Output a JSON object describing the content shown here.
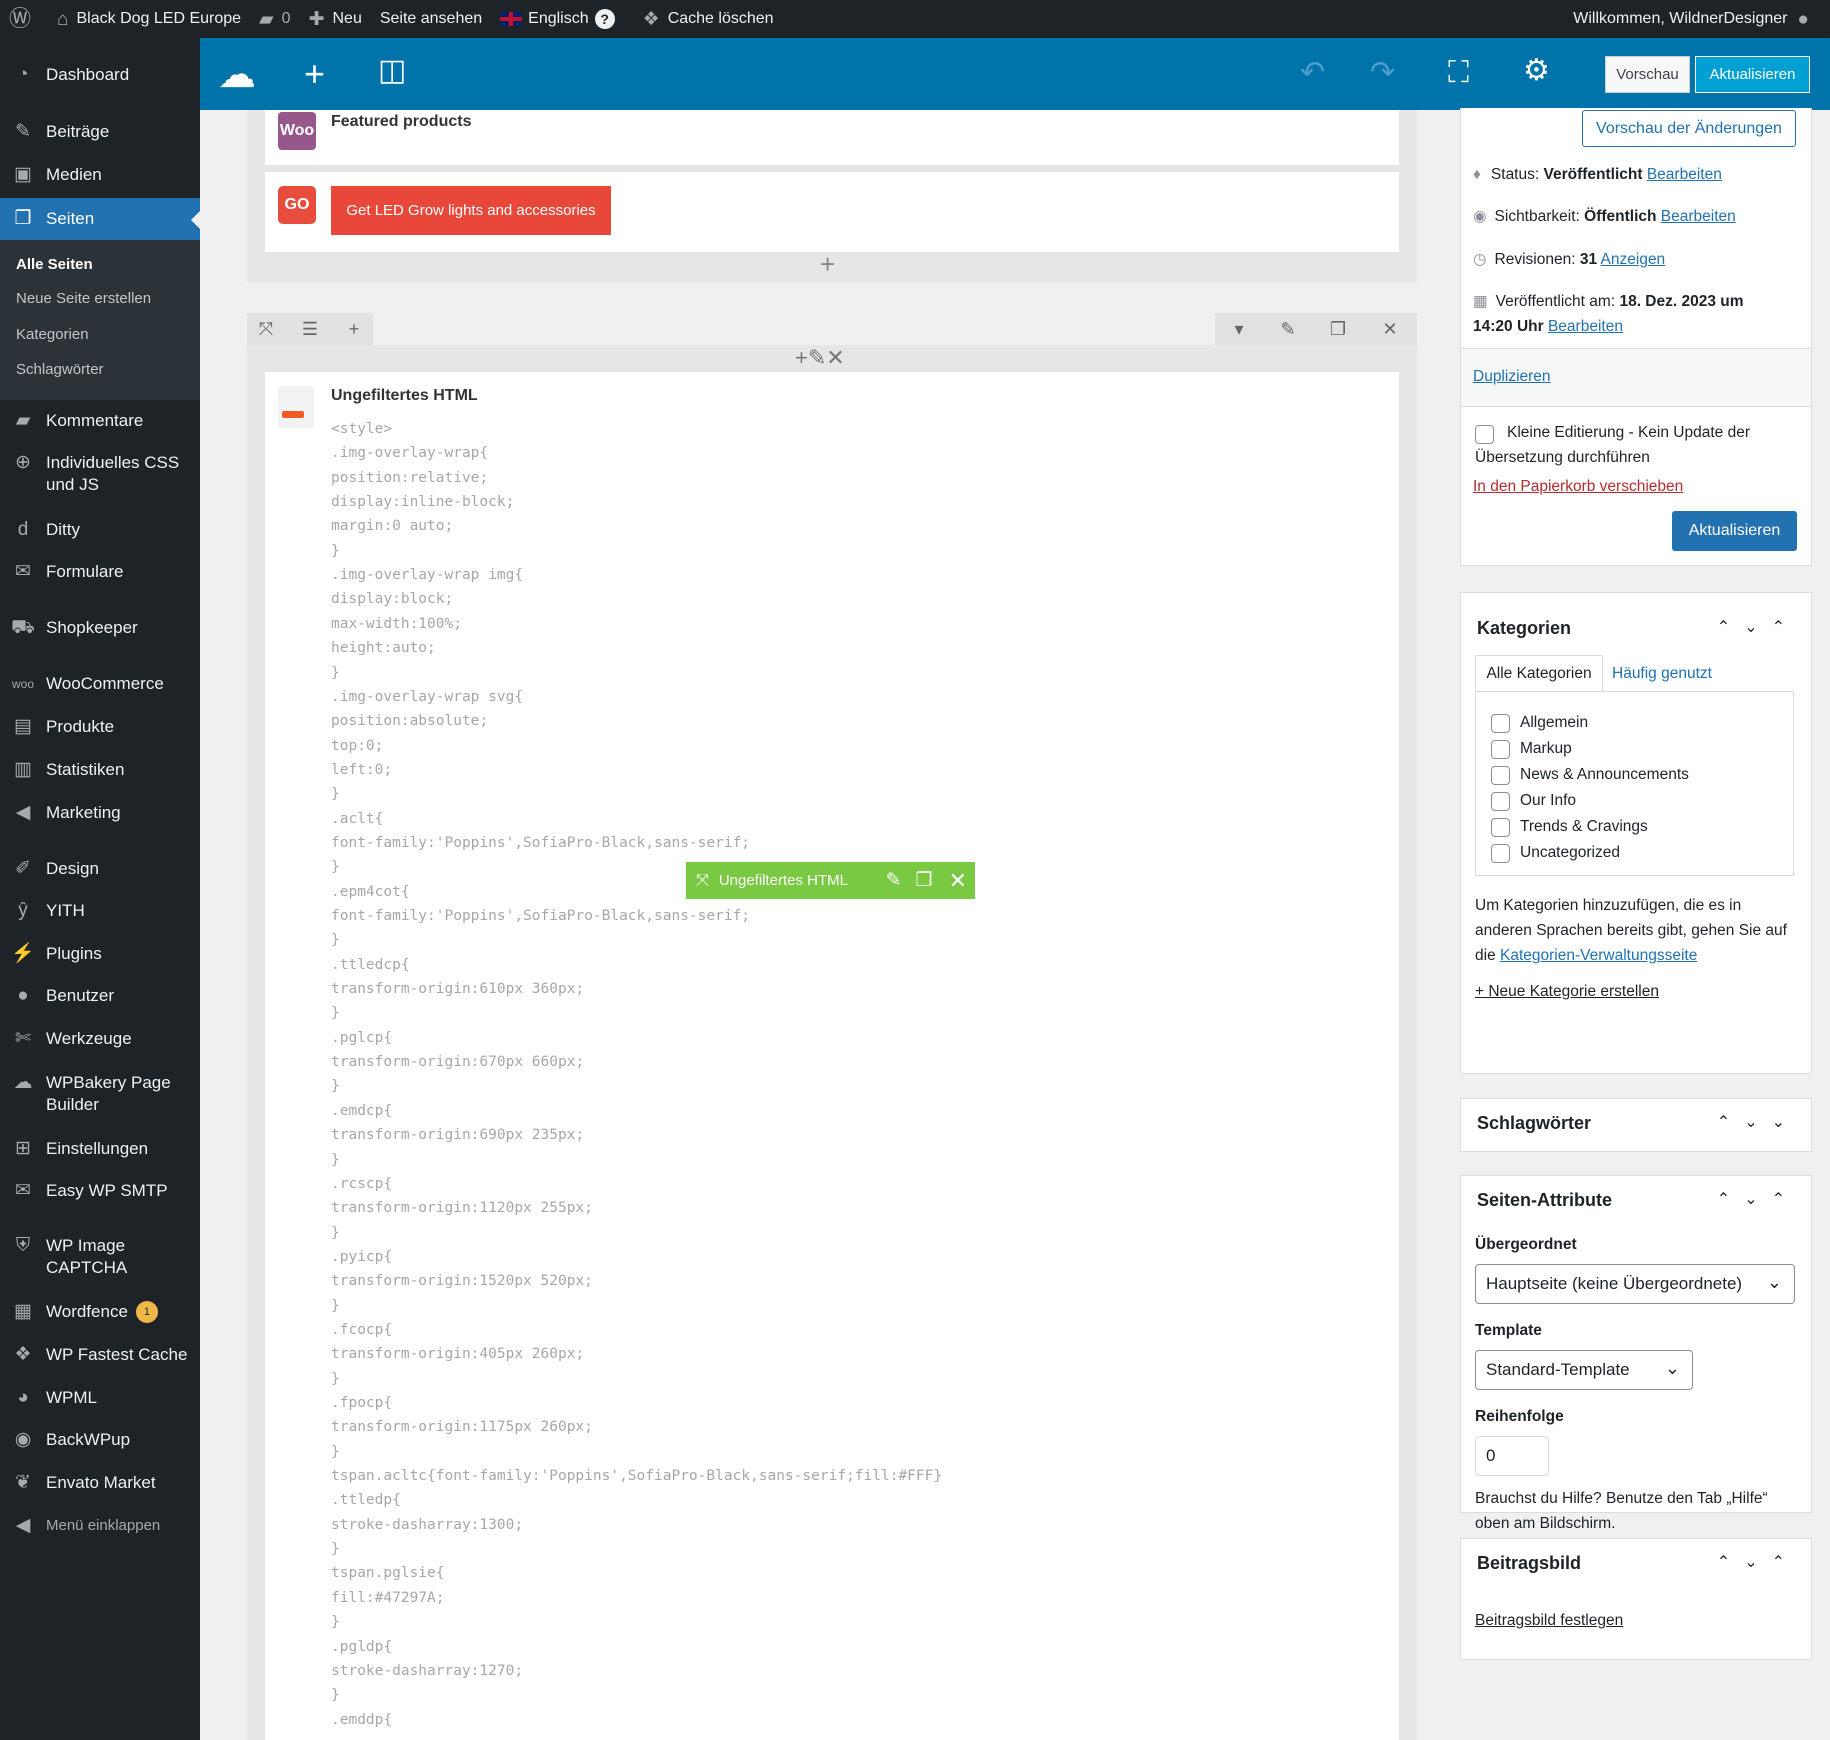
{
  "adminbar": {
    "site_name": "Black Dog LED Europe",
    "comments_count": "0",
    "new_label": "Neu",
    "view_page_label": "Seite ansehen",
    "language_label": "Englisch",
    "help_label": "?",
    "cache_label": "Cache löschen",
    "welcome": "Willkommen, WildnerDesigner"
  },
  "sidebar": {
    "items": [
      {
        "label": "Dashboard",
        "icon": "gauge-icon"
      },
      {
        "label": "Beiträge",
        "icon": "pin-icon"
      },
      {
        "label": "Medien",
        "icon": "media-icon"
      },
      {
        "label": "Seiten",
        "icon": "pages-icon"
      },
      {
        "label": "Kommentare",
        "icon": "comment-icon"
      },
      {
        "label": "Individuelles CSS und JS",
        "icon": "plus-circle-icon"
      },
      {
        "label": "Ditty",
        "icon": "ditty-icon"
      },
      {
        "label": "Formulare",
        "icon": "mail-icon"
      },
      {
        "label": "Shopkeeper",
        "icon": "cart-icon"
      },
      {
        "label": "WooCommerce",
        "icon": "woo-icon"
      },
      {
        "label": "Produkte",
        "icon": "archive-icon"
      },
      {
        "label": "Statistiken",
        "icon": "bar-chart-icon"
      },
      {
        "label": "Marketing",
        "icon": "megaphone-icon"
      },
      {
        "label": "Design",
        "icon": "brush-icon"
      },
      {
        "label": "YITH",
        "icon": "yith-icon"
      },
      {
        "label": "Plugins",
        "icon": "plug-icon"
      },
      {
        "label": "Benutzer",
        "icon": "user-icon"
      },
      {
        "label": "Werkzeuge",
        "icon": "wrench-icon"
      },
      {
        "label": "WPBakery Page Builder",
        "icon": "cloud-icon"
      },
      {
        "label": "Einstellungen",
        "icon": "settings-icon"
      },
      {
        "label": "Easy WP SMTP",
        "icon": "smtp-icon"
      },
      {
        "label": "WP Image CAPTCHA",
        "icon": "shield-icon"
      },
      {
        "label": "Wordfence",
        "icon": "wordfence-icon",
        "badge": "1"
      },
      {
        "label": "WP Fastest Cache",
        "icon": "cheetah-icon"
      },
      {
        "label": "WPML",
        "icon": "wpml-icon"
      },
      {
        "label": "BackWPup",
        "icon": "backwpup-icon"
      },
      {
        "label": "Envato Market",
        "icon": "leaf-icon"
      },
      {
        "label": "Menü einklappen",
        "icon": "collapse-icon"
      }
    ],
    "submenu": [
      "Alle Seiten",
      "Neue Seite erstellen",
      "Kategorien",
      "Schlagwörter"
    ]
  },
  "toolbar": {
    "preview_label": "Vorschau",
    "update_label": "Aktualisieren"
  },
  "editor": {
    "featured_title": "Featured products",
    "woo_logo": "Woo",
    "go_logo": "GO",
    "go_button": "Get LED Grow lights and accessories",
    "html_title": "Ungefiltertes HTML",
    "hover_label": "Ungefiltertes HTML",
    "code_lines": [
      "<style>",
      ".img-overlay-wrap{",
      "position:relative;",
      "display:inline-block;",
      "margin:0 auto;",
      "}",
      ".img-overlay-wrap img{",
      "display:block;",
      "max-width:100%;",
      "height:auto;",
      "}",
      ".img-overlay-wrap svg{",
      "position:absolute;",
      "top:0;",
      "left:0;",
      "}",
      ".aclt{",
      "font-family:'Poppins',SofiaPro-Black,sans-serif;",
      "}",
      ".epm4cot{",
      "font-family:'Poppins',SofiaPro-Black,sans-serif;",
      "}",
      ".ttledcp{",
      "transform-origin:610px 360px;",
      "}",
      ".pglcp{",
      "transform-origin:670px 660px;",
      "}",
      ".emdcp{",
      "transform-origin:690px 235px;",
      "}",
      ".rcscp{",
      "transform-origin:1120px 255px;",
      "}",
      ".pyicp{",
      "transform-origin:1520px 520px;",
      "}",
      ".fcocp{",
      "transform-origin:405px 260px;",
      "}",
      ".fpocp{",
      "transform-origin:1175px 260px;",
      "}",
      "tspan.acltc{font-family:'Poppins',SofiaPro-Black,sans-serif;fill:#FFF}",
      ".ttledp{",
      "stroke-dasharray:1300;",
      "}",
      "tspan.pglsie{",
      "fill:#47297A;",
      "}",
      ".pgldp{",
      "stroke-dasharray:1270;",
      "}",
      ".emddp{"
    ]
  },
  "publish": {
    "preview_changes": "Vorschau der Änderungen",
    "status_label": "Status:",
    "status_value": "Veröffentlicht",
    "visibility_label": "Sichtbarkeit:",
    "visibility_value": "Öffentlich",
    "revisions_label": "Revisionen:",
    "revisions_value": "31",
    "revisions_link": "Anzeigen",
    "published_label": "Veröffentlicht am:",
    "published_date": "18. Dez. 2023 um",
    "published_time": "14:20 Uhr",
    "edit_link": "Bearbeiten",
    "duplicate": "Duplizieren",
    "minor_edit": "Kleine Editierung - Kein Update der Übersetzung durchführen",
    "trash": "In den Papierkorb verschieben",
    "update": "Aktualisieren"
  },
  "categories": {
    "title": "Kategorien",
    "tab_all": "Alle Kategorien",
    "tab_popular": "Häufig genutzt",
    "items": [
      "Allgemein",
      "Markup",
      "News & Announcements",
      "Our Info",
      "Trends & Cravings",
      "Uncategorized"
    ],
    "help_text": "Um Kategorien hinzuzufügen, die es in anderen Sprachen bereits gibt, gehen Sie auf die",
    "help_link": "Kategorien-Verwaltungsseite",
    "new_link": "+ Neue Kategorie erstellen"
  },
  "tags": {
    "title": "Schlagwörter"
  },
  "attributes": {
    "title": "Seiten-Attribute",
    "parent_label": "Übergeordnet",
    "parent_value": "Hauptseite (keine Übergeordnete)",
    "template_label": "Template",
    "template_value": "Standard-Template",
    "order_label": "Reihenfolge",
    "order_value": "0",
    "help": "Brauchst du Hilfe? Benutze den Tab „Hilfe“ oben am Bildschirm."
  },
  "featured_image": {
    "title": "Beitragsbild",
    "link": "Beitragsbild festlegen"
  },
  "colors": {
    "accent": "#2271b1",
    "toolbar": "#0073aa",
    "sidebar": "#1d2327",
    "hover_bar": "#7ac943",
    "go_button": "#e8473a"
  }
}
